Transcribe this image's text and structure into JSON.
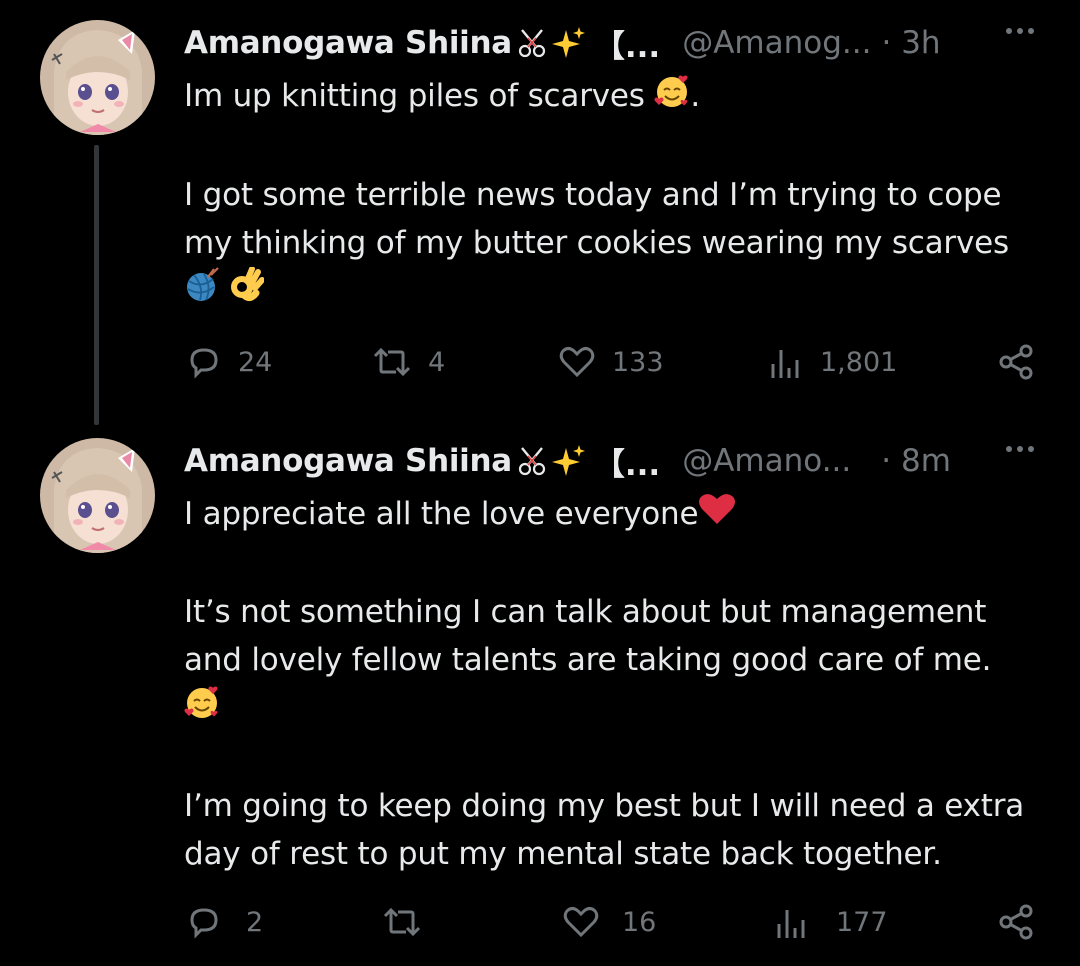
{
  "tweets": [
    {
      "display_name": "Amanogawa Shiina",
      "name_emojis": [
        "scissors-icon",
        "sparkles-icon"
      ],
      "name_bracket": "【...",
      "handle": "@Amanog...",
      "time": "· 3h",
      "lines": [
        "Im up knitting piles of scarves",
        "",
        "I got some terrible news today and I’m trying to cope",
        "my thinking of my butter cookies wearing my scarves"
      ],
      "line1_suffix": ".",
      "actions": {
        "replies": "24",
        "retweets": "4",
        "likes": "133",
        "views": "1,801"
      }
    },
    {
      "display_name": "Amanogawa Shiina",
      "name_emojis": [
        "scissors-icon",
        "sparkles-icon"
      ],
      "name_bracket": "【...",
      "handle": "@Amano...",
      "time": "· 8m",
      "lines": [
        "I appreciate all the love everyone",
        "",
        "It’s not something I can talk about but management",
        "and lovely fellow talents are taking good care of me.",
        "",
        "",
        "I’m going to keep doing my best but I will need a extra",
        "day of rest to put my mental state back together."
      ],
      "actions": {
        "replies": "2",
        "retweets": "",
        "likes": "16",
        "views": "177"
      }
    }
  ],
  "colors": {
    "background": "#000000",
    "text": "#e7e9ea",
    "secondary": "#71767b",
    "thread_line": "#333639"
  }
}
